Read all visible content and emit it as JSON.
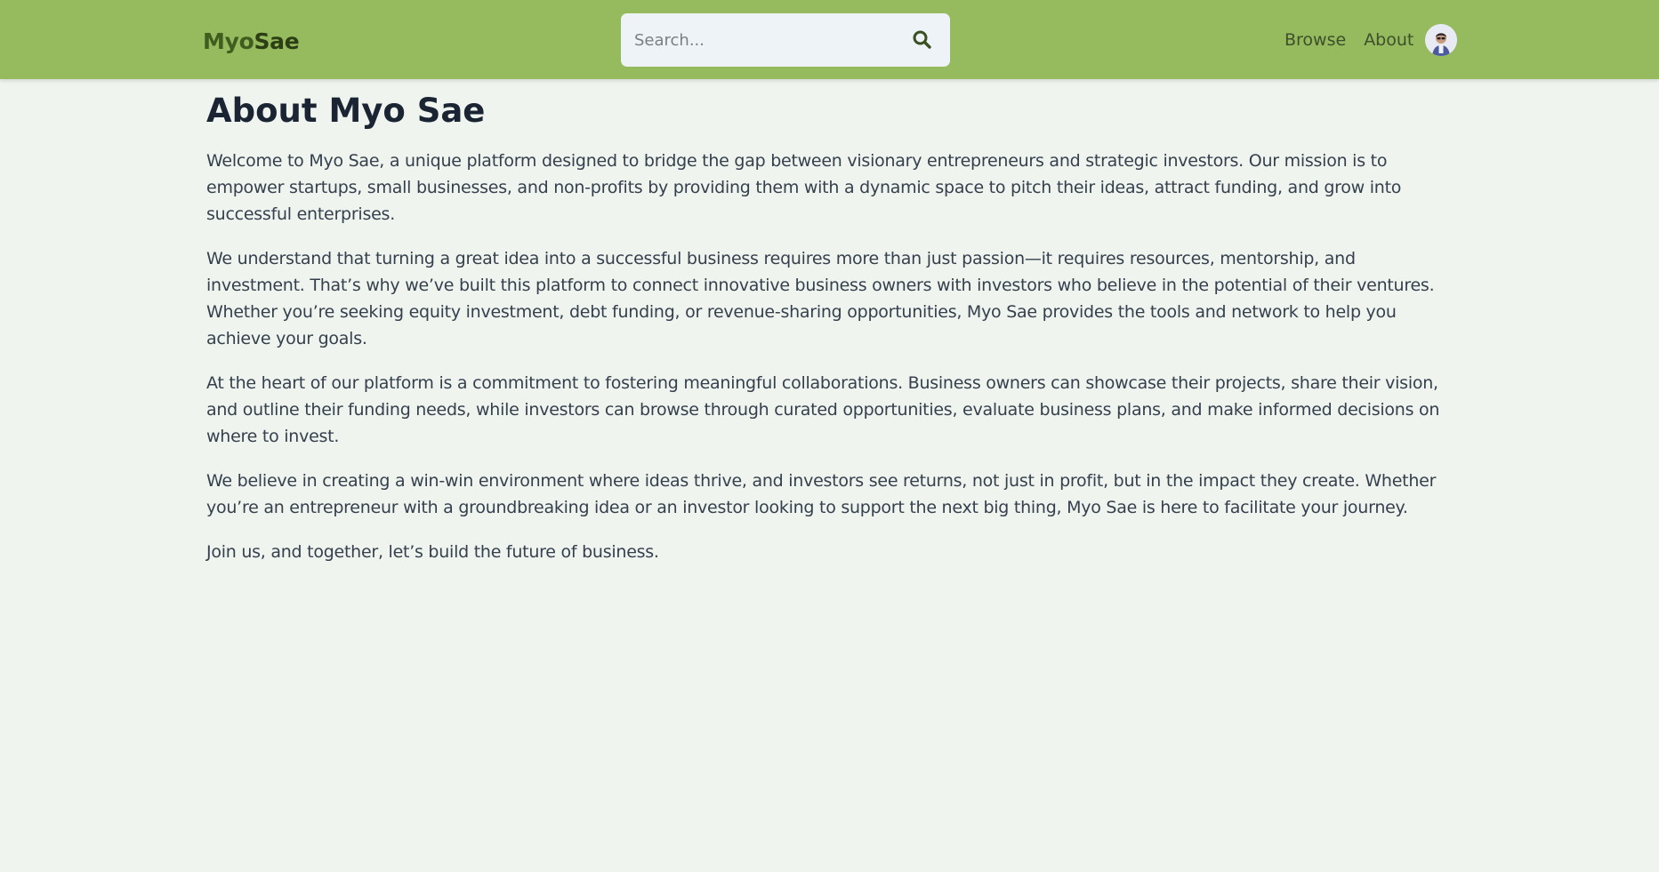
{
  "header": {
    "logo_part1": "Myo",
    "logo_part2": "Sae",
    "search_placeholder": "Search...",
    "search_icon": "search-icon",
    "nav": [
      {
        "label": "Browse"
      },
      {
        "label": "About"
      }
    ],
    "avatar_icon": "user-avatar"
  },
  "main": {
    "title": "About Myo Sae",
    "paragraphs": [
      "Welcome to Myo Sae, a unique platform designed to bridge the gap between visionary entrepreneurs and strategic investors. Our mission is to empower startups, small businesses, and non-profits by providing them with a dynamic space to pitch their ideas, attract funding, and grow into successful enterprises.",
      "We understand that turning a great idea into a successful business requires more than just passion—it requires resources, mentorship, and investment. That’s why we’ve built this platform to connect innovative business owners with investors who believe in the potential of their ventures. Whether you’re seeking equity investment, debt funding, or revenue-sharing opportunities, Myo Sae provides the tools and network to help you achieve your goals.",
      "At the heart of our platform is a commitment to fostering meaningful collaborations. Business owners can showcase their projects, share their vision, and outline their funding needs, while investors can browse through curated opportunities, evaluate business plans, and make informed decisions on where to invest.",
      "We believe in creating a win-win environment where ideas thrive, and investors see returns, not just in profit, but in the impact they create. Whether you’re an entrepreneur with a groundbreaking idea or an investor looking to support the next big thing, Myo Sae is here to facilitate your journey.",
      "Join us, and together, let’s build the future of business."
    ]
  },
  "colors": {
    "navbar_bg": "#96bb5f",
    "page_bg": "#eff4ef",
    "title": "#1a2433",
    "body_text": "#36404d"
  }
}
